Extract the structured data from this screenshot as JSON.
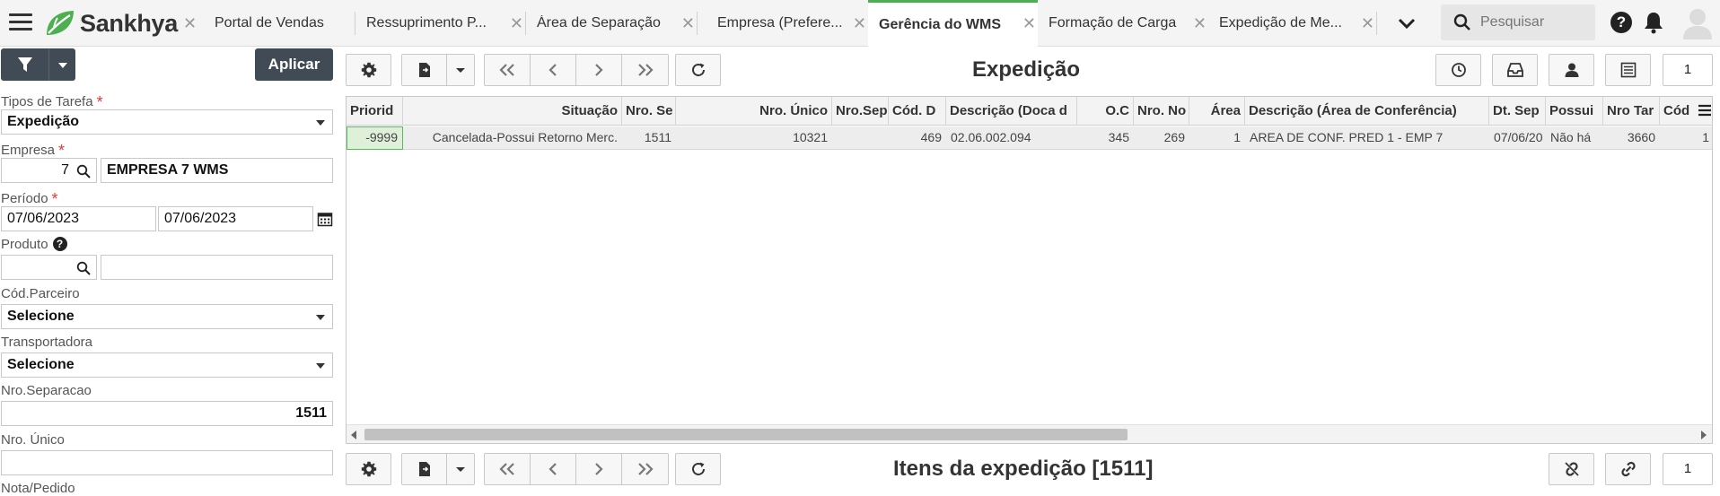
{
  "app": {
    "brand": "Sankhya"
  },
  "tabs": [
    {
      "label": "Portal de Vendas",
      "active": false
    },
    {
      "label": "Ressuprimento P...",
      "active": false
    },
    {
      "label": "Área de Separação",
      "active": false
    },
    {
      "label": "Empresa (Prefere...",
      "active": false
    },
    {
      "label": "Gerência do WMS",
      "active": true
    },
    {
      "label": "Formação de Carga",
      "active": false
    },
    {
      "label": "Expedição de Me...",
      "active": false
    }
  ],
  "search": {
    "placeholder": "Pesquisar"
  },
  "filter": {
    "apply_label": "Aplicar",
    "tipos_tarefa": {
      "label": "Tipos de Tarefa",
      "value": "Expedição"
    },
    "empresa": {
      "label": "Empresa",
      "code": "7",
      "name": "EMPRESA 7 WMS"
    },
    "periodo": {
      "label": "Período",
      "start": "07/06/2023",
      "end": "07/06/2023"
    },
    "produto": {
      "label": "Produto",
      "code": "",
      "name": ""
    },
    "cod_parceiro": {
      "label": "Cód.Parceiro",
      "value": "Selecione"
    },
    "transportadora": {
      "label": "Transportadora",
      "value": "Selecione"
    },
    "nro_separacao": {
      "label": "Nro.Separacao",
      "value": "1511"
    },
    "nro_unico": {
      "label": "Nro. Único",
      "value": ""
    },
    "nota_pedido": {
      "label": "Nota/Pedido"
    }
  },
  "expedicao": {
    "title": "Expedição",
    "page": "1",
    "columns": [
      "Priorid",
      "Situação",
      "Nro. Se",
      "Nro. Único",
      "Nro.Sep",
      "Cód. D",
      "Descrição (Doca d",
      "O.C",
      "Nro. No",
      "Área",
      "Descrição (Área de Conferência)",
      "Dt. Sep",
      "Possui",
      "Nro Tar",
      "Cód"
    ],
    "rows": [
      [
        "-9999",
        "Cancelada-Possui Retorno Merc.",
        "1511",
        "10321",
        "",
        "469",
        "02.06.002.094",
        "345",
        "269",
        "1",
        "AREA DE CONF. PRED 1 - EMP 7",
        "07/06/20",
        "Não há",
        "3660",
        "1"
      ]
    ]
  },
  "itens": {
    "title": "Itens da expedição [1511]",
    "page": "1"
  },
  "colors": {
    "accent": "#4caf50",
    "dark_button": "#404b55",
    "required": "#e53935"
  }
}
